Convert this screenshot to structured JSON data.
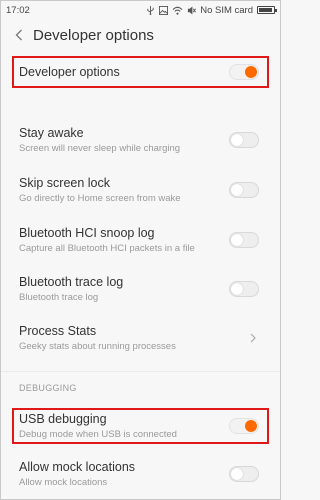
{
  "status_bar": {
    "time": "17:02",
    "carrier": "No SIM card",
    "icons": [
      "usb-icon",
      "gallery-icon",
      "wifi-icon",
      "mute-icon",
      "battery-icon"
    ]
  },
  "header": {
    "back_icon": "chevron-left-icon",
    "title": "Developer options"
  },
  "master_switch": {
    "label": "Developer options",
    "enabled": true
  },
  "settings": [
    {
      "label": "Stay awake",
      "summary": "Screen will never sleep while charging",
      "enabled": false
    },
    {
      "label": "Skip screen lock",
      "summary": "Go directly to Home screen from wake",
      "enabled": false
    },
    {
      "label": "Bluetooth HCI snoop log",
      "summary": "Capture all Bluetooth HCI packets in a file",
      "enabled": false
    },
    {
      "label": "Bluetooth trace log",
      "summary": "Bluetooth trace log",
      "enabled": false
    },
    {
      "label": "Process Stats",
      "summary": "Geeky stats about running processes"
    }
  ],
  "debugging": {
    "header": "DEBUGGING",
    "items": [
      {
        "label": "USB debugging",
        "summary": "Debug mode when USB is connected",
        "enabled": true
      },
      {
        "label": "Allow mock locations",
        "summary": "Allow mock locations",
        "enabled": false
      }
    ]
  },
  "colors": {
    "accent": "#ff6a00",
    "highlight_border": "#e01818",
    "summary_text": "#9a9a9a"
  }
}
